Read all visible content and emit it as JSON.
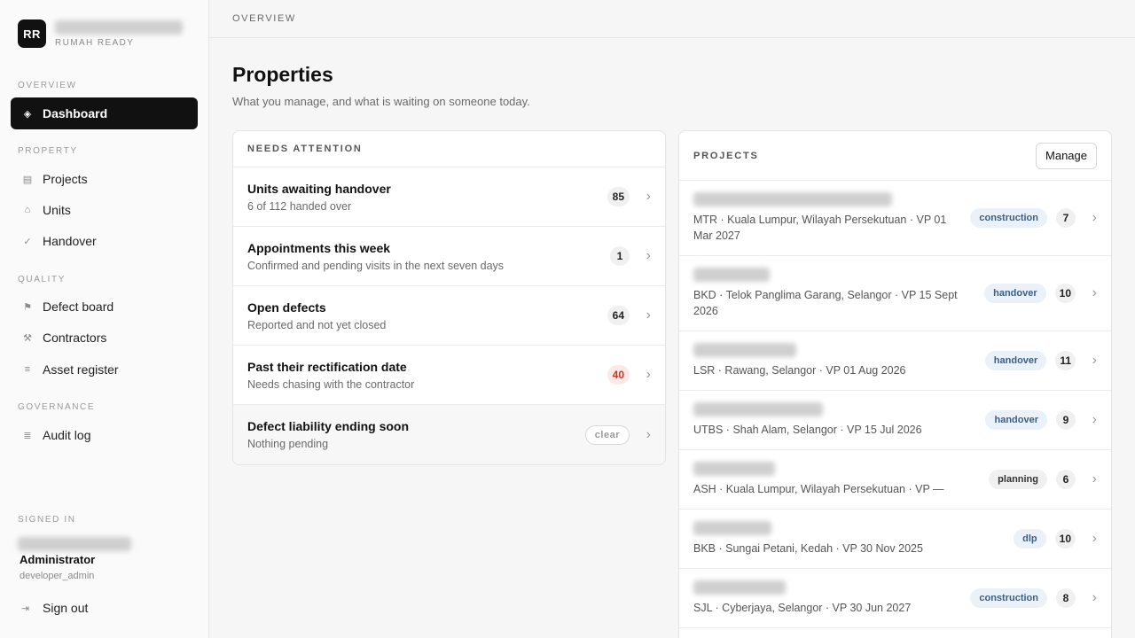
{
  "brand": {
    "logo": "RR",
    "subtitle": "RUMAH READY"
  },
  "sidebar": {
    "sections": [
      {
        "label": "OVERVIEW",
        "items": [
          {
            "label": "Dashboard",
            "icon": "diamond-icon",
            "glyph": "◈",
            "active": true
          }
        ]
      },
      {
        "label": "PROPERTY",
        "items": [
          {
            "label": "Projects",
            "icon": "building-icon",
            "glyph": "▤"
          },
          {
            "label": "Units",
            "icon": "home-icon",
            "glyph": "⌂"
          },
          {
            "label": "Handover",
            "icon": "check-icon",
            "glyph": "✓"
          }
        ]
      },
      {
        "label": "QUALITY",
        "items": [
          {
            "label": "Defect board",
            "icon": "flag-icon",
            "glyph": "⚑"
          },
          {
            "label": "Contractors",
            "icon": "tools-icon",
            "glyph": "⚒"
          },
          {
            "label": "Asset register",
            "icon": "list-icon",
            "glyph": "≡"
          }
        ]
      },
      {
        "label": "GOVERNANCE",
        "items": [
          {
            "label": "Audit log",
            "icon": "log-icon",
            "glyph": "≣"
          }
        ]
      }
    ],
    "signed_in_label": "SIGNED IN",
    "user_role": "Administrator",
    "user_handle": "developer_admin",
    "sign_out": {
      "label": "Sign out",
      "glyph": "⇥"
    }
  },
  "topbar": {
    "breadcrumb": "OVERVIEW"
  },
  "main": {
    "title": "Properties",
    "subtitle": "What you manage, and what is waiting on someone today."
  },
  "attention": {
    "heading": "NEEDS ATTENTION",
    "items": [
      {
        "title": "Units awaiting handover",
        "desc": "6 of 112 handed over",
        "badge": "85",
        "style": "normal"
      },
      {
        "title": "Appointments this week",
        "desc": "Confirmed and pending visits in the next seven days",
        "badge": "1",
        "style": "normal"
      },
      {
        "title": "Open defects",
        "desc": "Reported and not yet closed",
        "badge": "64",
        "style": "normal"
      },
      {
        "title": "Past their rectification date",
        "desc": "Needs chasing with the contractor",
        "badge": "40",
        "style": "red"
      },
      {
        "title": "Defect liability ending soon",
        "desc": "Nothing pending",
        "badge": "clear",
        "style": "clear"
      }
    ]
  },
  "projects": {
    "heading": "PROJECTS",
    "manage_label": "Manage",
    "items": [
      {
        "meta": "MTR · Kuala Lumpur, Wilayah Persekutuan · VP 01 Mar 2027",
        "status": "construction",
        "count": "7"
      },
      {
        "meta": "BKD · Telok Panglima Garang, Selangor · VP 15 Sept 2026",
        "status": "handover",
        "count": "10"
      },
      {
        "meta": "LSR · Rawang, Selangor · VP 01 Aug 2026",
        "status": "handover",
        "count": "11"
      },
      {
        "meta": "UTBS · Shah Alam, Selangor · VP 15 Jul 2026",
        "status": "handover",
        "count": "9"
      },
      {
        "meta": "ASH · Kuala Lumpur, Wilayah Persekutuan · VP —",
        "status": "planning",
        "count": "6"
      },
      {
        "meta": "BKB · Sungai Petani, Kedah · VP 30 Nov 2025",
        "status": "dlp",
        "count": "10"
      },
      {
        "meta": "SJL · Cyberjaya, Selangor · VP 30 Jun 2027",
        "status": "construction",
        "count": "8"
      }
    ]
  }
}
